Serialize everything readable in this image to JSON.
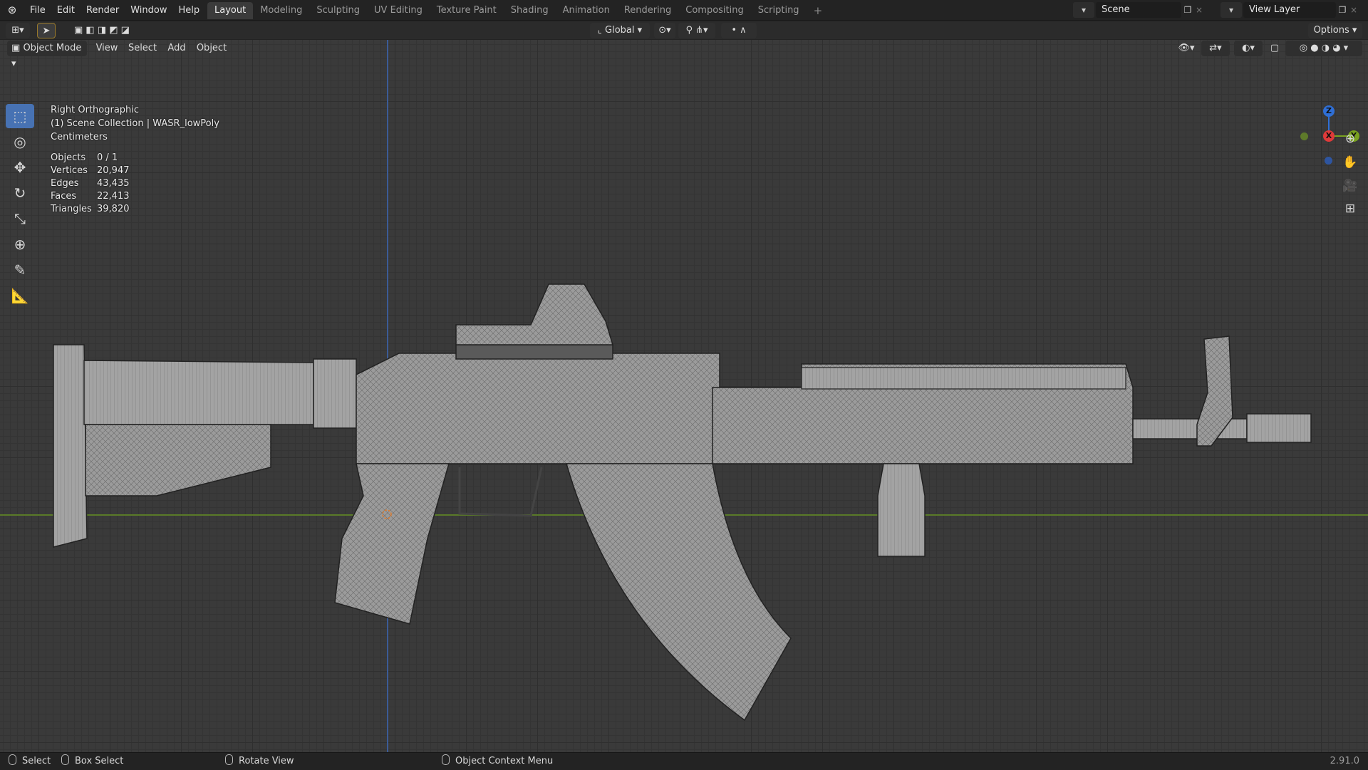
{
  "menu": [
    "File",
    "Edit",
    "Render",
    "Window",
    "Help"
  ],
  "workspaces": [
    {
      "label": "Layout",
      "active": true
    },
    {
      "label": "Modeling",
      "active": false
    },
    {
      "label": "Sculpting",
      "active": false
    },
    {
      "label": "UV Editing",
      "active": false
    },
    {
      "label": "Texture Paint",
      "active": false
    },
    {
      "label": "Shading",
      "active": false
    },
    {
      "label": "Animation",
      "active": false
    },
    {
      "label": "Rendering",
      "active": false
    },
    {
      "label": "Compositing",
      "active": false
    },
    {
      "label": "Scripting",
      "active": false
    }
  ],
  "scene": {
    "name": "Scene"
  },
  "view_layer": {
    "name": "View Layer"
  },
  "tool_header": {
    "transform_orientation": "Global",
    "options_label": "Options"
  },
  "viewport_header": {
    "mode": "Object Mode",
    "menus": [
      "View",
      "Select",
      "Add",
      "Object"
    ]
  },
  "overlay": {
    "view_name": "Right Orthographic",
    "collection": "(1) Scene Collection | WASR_lowPoly",
    "units": "Centimeters",
    "stats": [
      {
        "label": "Objects",
        "value": "0 / 1"
      },
      {
        "label": "Vertices",
        "value": "20,947"
      },
      {
        "label": "Edges",
        "value": "43,435"
      },
      {
        "label": "Faces",
        "value": "22,413"
      },
      {
        "label": "Triangles",
        "value": "39,820"
      }
    ]
  },
  "gizmo": {
    "z": "Z",
    "x": "X",
    "y": "Y"
  },
  "statusbar": {
    "select": "Select",
    "box_select": "Box Select",
    "rotate_view": "Rotate View",
    "context_menu": "Object Context Menu",
    "version": "2.91.0"
  },
  "colors": {
    "accent": "#4772b3",
    "axis_z": "#3b5b96",
    "axis_y": "#5a7a28",
    "viewport_bg": "#3a3a3a"
  }
}
